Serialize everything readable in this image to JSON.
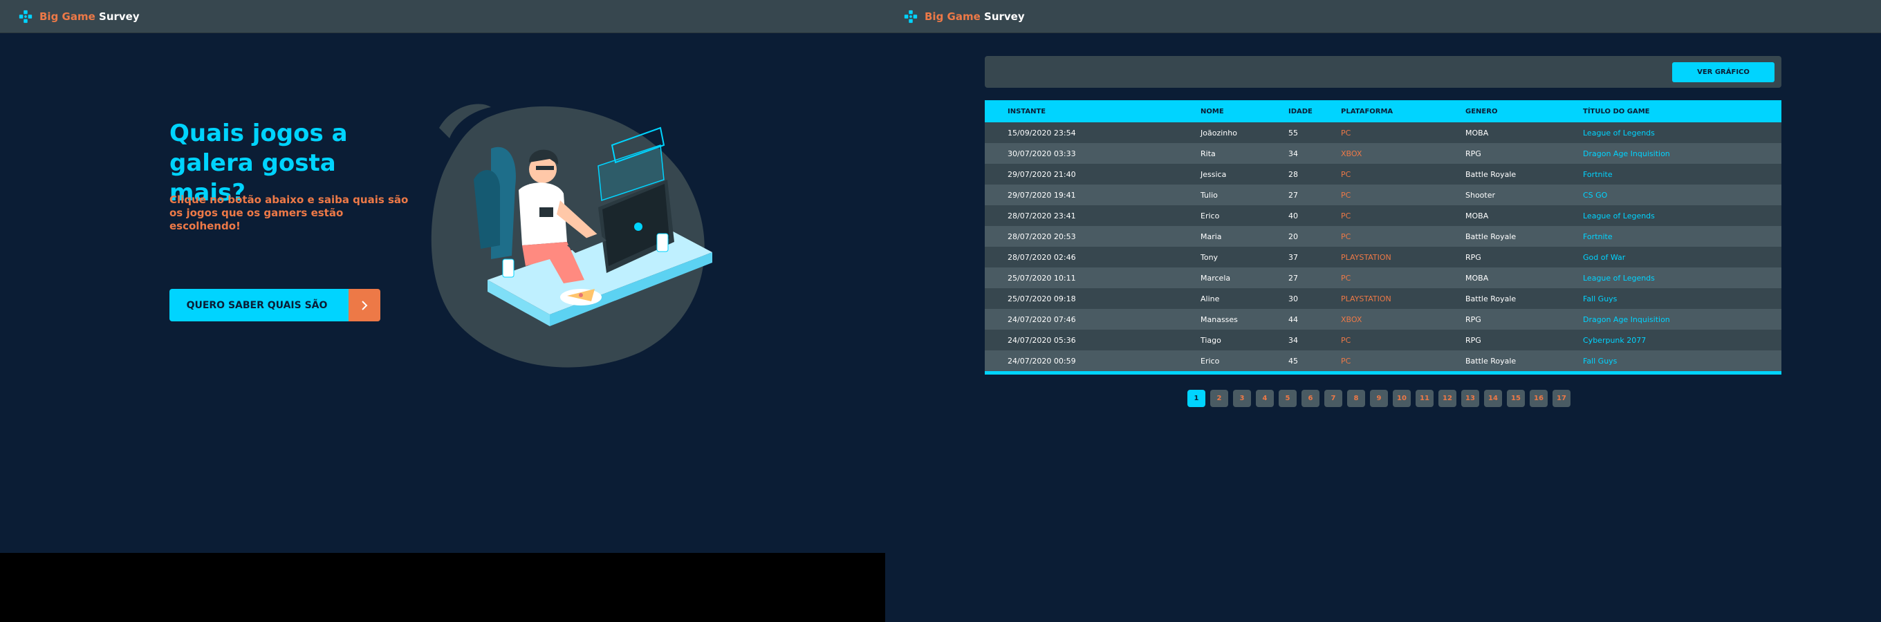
{
  "brand": {
    "big": "Big Game",
    "survey": "Survey"
  },
  "home": {
    "title": "Quais jogos a galera gosta mais?",
    "subtitle": "Clique no botão abaixo e saiba quais são os jogos que os gamers estão escolhendo!",
    "cta_label": "QUERO SABER QUAIS SÃO",
    "illustration": "gamer-at-desk-illustration"
  },
  "records": {
    "chart_button": "VER GRÁFICO",
    "columns": [
      "INSTANTE",
      "NOME",
      "IDADE",
      "PLATAFORMA",
      "GENERO",
      "TÍTULO DO GAME"
    ],
    "rows": [
      {
        "instante": "15/09/2020 23:54",
        "nome": "Joãozinho",
        "idade": "55",
        "plataforma": "PC",
        "genero": "MOBA",
        "titulo": "League of Legends"
      },
      {
        "instante": "30/07/2020 03:33",
        "nome": "Rita",
        "idade": "34",
        "plataforma": "XBOX",
        "genero": "RPG",
        "titulo": "Dragon Age Inquisition"
      },
      {
        "instante": "29/07/2020 21:40",
        "nome": "Jessica",
        "idade": "28",
        "plataforma": "PC",
        "genero": "Battle Royale",
        "titulo": "Fortnite"
      },
      {
        "instante": "29/07/2020 19:41",
        "nome": "Tulio",
        "idade": "27",
        "plataforma": "PC",
        "genero": "Shooter",
        "titulo": "CS GO"
      },
      {
        "instante": "28/07/2020 23:41",
        "nome": "Erico",
        "idade": "40",
        "plataforma": "PC",
        "genero": "MOBA",
        "titulo": "League of Legends"
      },
      {
        "instante": "28/07/2020 20:53",
        "nome": "Maria",
        "idade": "20",
        "plataforma": "PC",
        "genero": "Battle Royale",
        "titulo": "Fortnite"
      },
      {
        "instante": "28/07/2020 02:46",
        "nome": "Tony",
        "idade": "37",
        "plataforma": "PLAYSTATION",
        "genero": "RPG",
        "titulo": "God of War"
      },
      {
        "instante": "25/07/2020 10:11",
        "nome": "Marcela",
        "idade": "27",
        "plataforma": "PC",
        "genero": "MOBA",
        "titulo": "League of Legends"
      },
      {
        "instante": "25/07/2020 09:18",
        "nome": "Aline",
        "idade": "30",
        "plataforma": "PLAYSTATION",
        "genero": "Battle Royale",
        "titulo": "Fall Guys"
      },
      {
        "instante": "24/07/2020 07:46",
        "nome": "Manasses",
        "idade": "44",
        "plataforma": "XBOX",
        "genero": "RPG",
        "titulo": "Dragon Age Inquisition"
      },
      {
        "instante": "24/07/2020 05:36",
        "nome": "Tiago",
        "idade": "34",
        "plataforma": "PC",
        "genero": "RPG",
        "titulo": "Cyberpunk 2077"
      },
      {
        "instante": "24/07/2020 00:59",
        "nome": "Erico",
        "idade": "45",
        "plataforma": "PC",
        "genero": "Battle Royale",
        "titulo": "Fall Guys"
      }
    ],
    "pagination": {
      "pages": [
        "1",
        "2",
        "3",
        "4",
        "5",
        "6",
        "7",
        "8",
        "9",
        "10",
        "11",
        "12",
        "13",
        "14",
        "15",
        "16",
        "17"
      ],
      "active": "1"
    }
  },
  "colors": {
    "background": "#0b1d35",
    "bar": "#37474f",
    "primary": "#00d4ff",
    "accent": "#ed7947"
  }
}
